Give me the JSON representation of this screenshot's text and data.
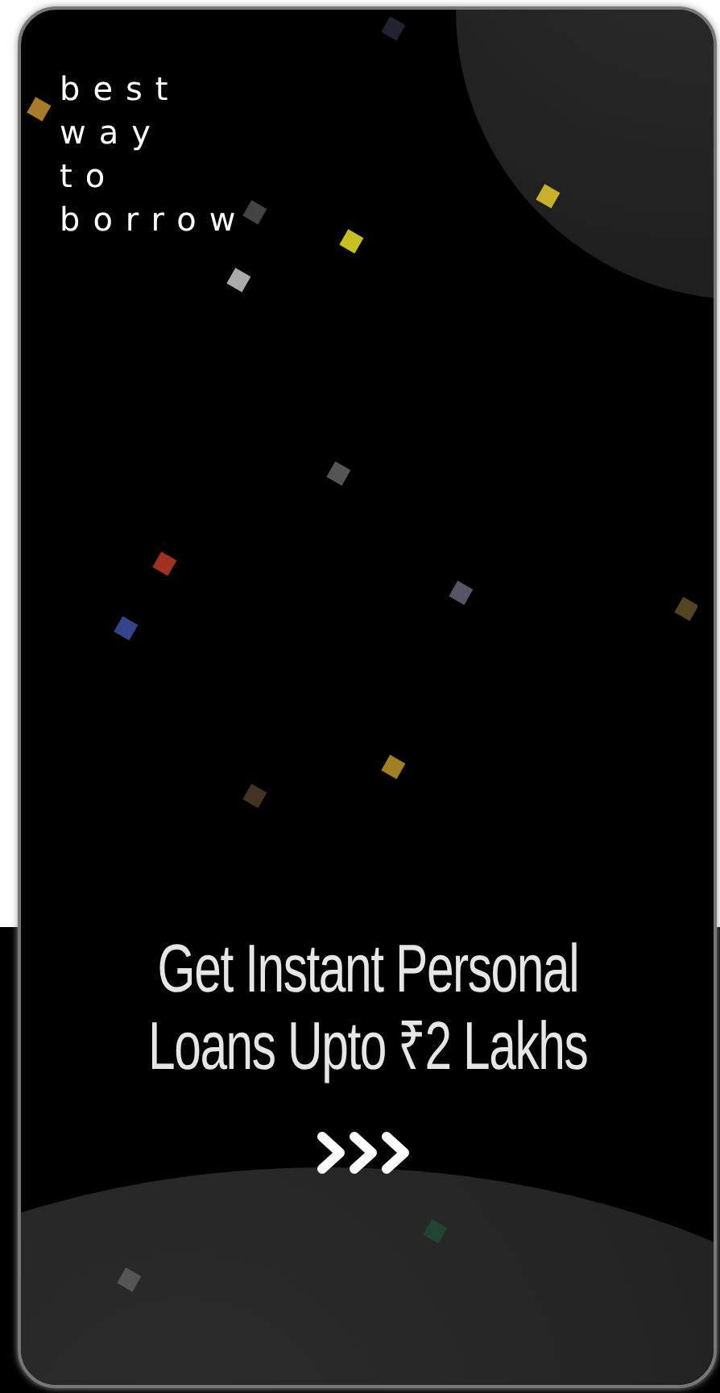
{
  "logo": {
    "lines": [
      "best",
      "way",
      "to",
      "borrow"
    ]
  },
  "headline": [
    "Get Instant Personal",
    "Loans Upto ₹2 Lakhs"
  ]
}
